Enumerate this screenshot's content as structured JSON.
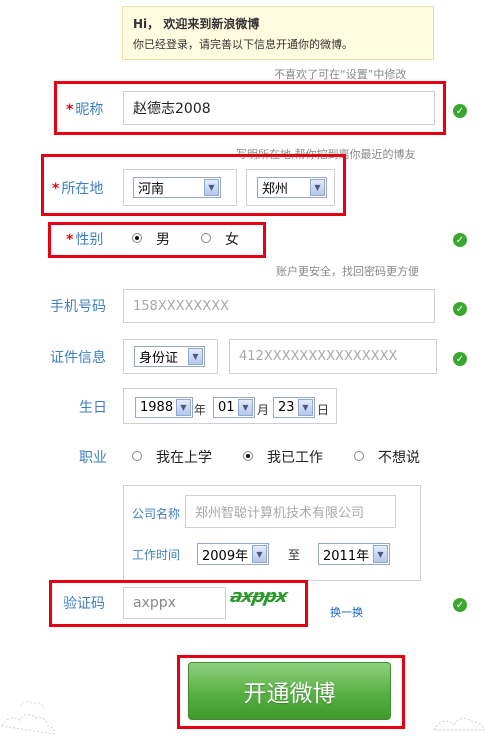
{
  "welcome": {
    "title": "Hi， 欢迎来到新浪微博",
    "subtitle": "你已经登录，请完善以下信息开通你的微博。",
    "settings_hint": "不喜欢了可在“设置”中修改"
  },
  "nickname": {
    "label": "昵称",
    "value": "赵德志2008"
  },
  "location": {
    "hint": "写明所在地,帮你挖到离你最近的博友",
    "label": "所在地",
    "province": "河南",
    "city": "郑州"
  },
  "gender": {
    "label": "性别",
    "options": [
      "男",
      "女"
    ],
    "selected": "男"
  },
  "phone": {
    "hint": "账户更安全，找回密码更方便",
    "label": "手机号码",
    "value": "158XXXXXXXX"
  },
  "id_info": {
    "label": "证件信息",
    "type": "身份证",
    "value": "412XXXXXXXXXXXXXXX"
  },
  "birthday": {
    "label": "生日",
    "year": "1988",
    "year_unit": "年",
    "month": "01",
    "month_unit": "月",
    "day": "23",
    "day_unit": "日"
  },
  "job": {
    "label": "职业",
    "options": [
      "我在上学",
      "我已工作",
      "不想说"
    ],
    "selected": "我已工作",
    "company_label": "公司名称",
    "company_value": "郑州智聪计算机技术有限公司",
    "worktime_label": "工作时间",
    "start": "2009年",
    "to": "至",
    "end": "2011年"
  },
  "captcha": {
    "label": "验证码",
    "value": "axppx",
    "image_text": "axppx",
    "refresh": "换一换"
  },
  "submit": {
    "label": "开通微博"
  },
  "colors": {
    "label_blue": "#3f7fbf",
    "green": "#58b043",
    "highlight_red": "#e60012",
    "required_red": "#d01010"
  }
}
